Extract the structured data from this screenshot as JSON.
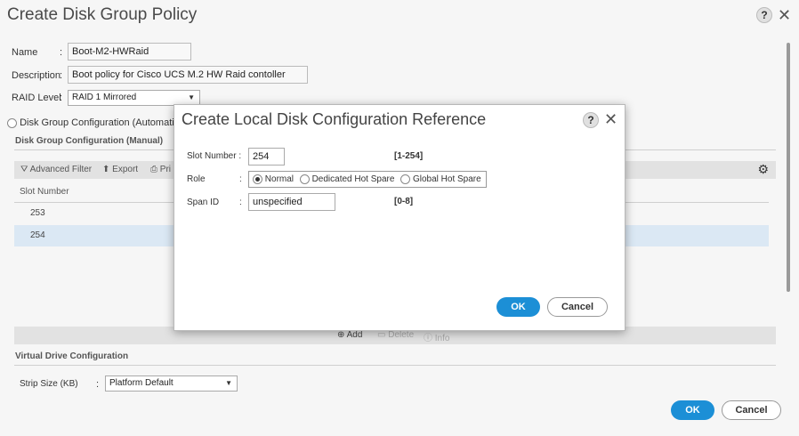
{
  "background": {
    "title": "Create Disk Group Policy",
    "help_glyph": "?",
    "close_glyph": "✕",
    "name_label": "Name",
    "name_value": "Boot-M2-HWRaid",
    "description_label": "Description",
    "description_value": "Boot policy for Cisco UCS M.2 HW Raid contoller",
    "raid_label": "RAID Level",
    "raid_value": "RAID 1 Mirrored",
    "auto_config_label": "Disk Group Configuration (Automatic)",
    "manual_section": "Disk Group Configuration (Manual)",
    "toolbar": {
      "advanced_filter": "Advanced Filter",
      "export": "Export",
      "print": "Pri"
    },
    "table": {
      "column_slot": "Slot Number",
      "rows": [
        "253",
        "254"
      ]
    },
    "bottombar": {
      "add": "Add",
      "delete": "Delete",
      "info": "Info"
    },
    "virtual_drive_section": "Virtual Drive Configuration",
    "strip_size_label": "Strip Size (KB)",
    "strip_size_value": "Platform Default",
    "ok": "OK",
    "cancel": "Cancel",
    "colon": ":"
  },
  "modal": {
    "title": "Create Local Disk Configuration Reference",
    "help_glyph": "?",
    "close_glyph": "✕",
    "slot_label": "Slot Number :",
    "slot_value": "254",
    "slot_range": "[1-254]",
    "role_label": "Role",
    "role_options": [
      "Normal",
      "Dedicated Hot Spare",
      "Global Hot Spare"
    ],
    "role_selected": "Normal",
    "span_label": "Span ID",
    "span_value": "unspecified",
    "span_range": "[0-8]",
    "ok": "OK",
    "cancel": "Cancel",
    "colon": ":"
  },
  "colors": {
    "accent": "#1c8fd6",
    "selected_row": "#dbe8f4"
  }
}
